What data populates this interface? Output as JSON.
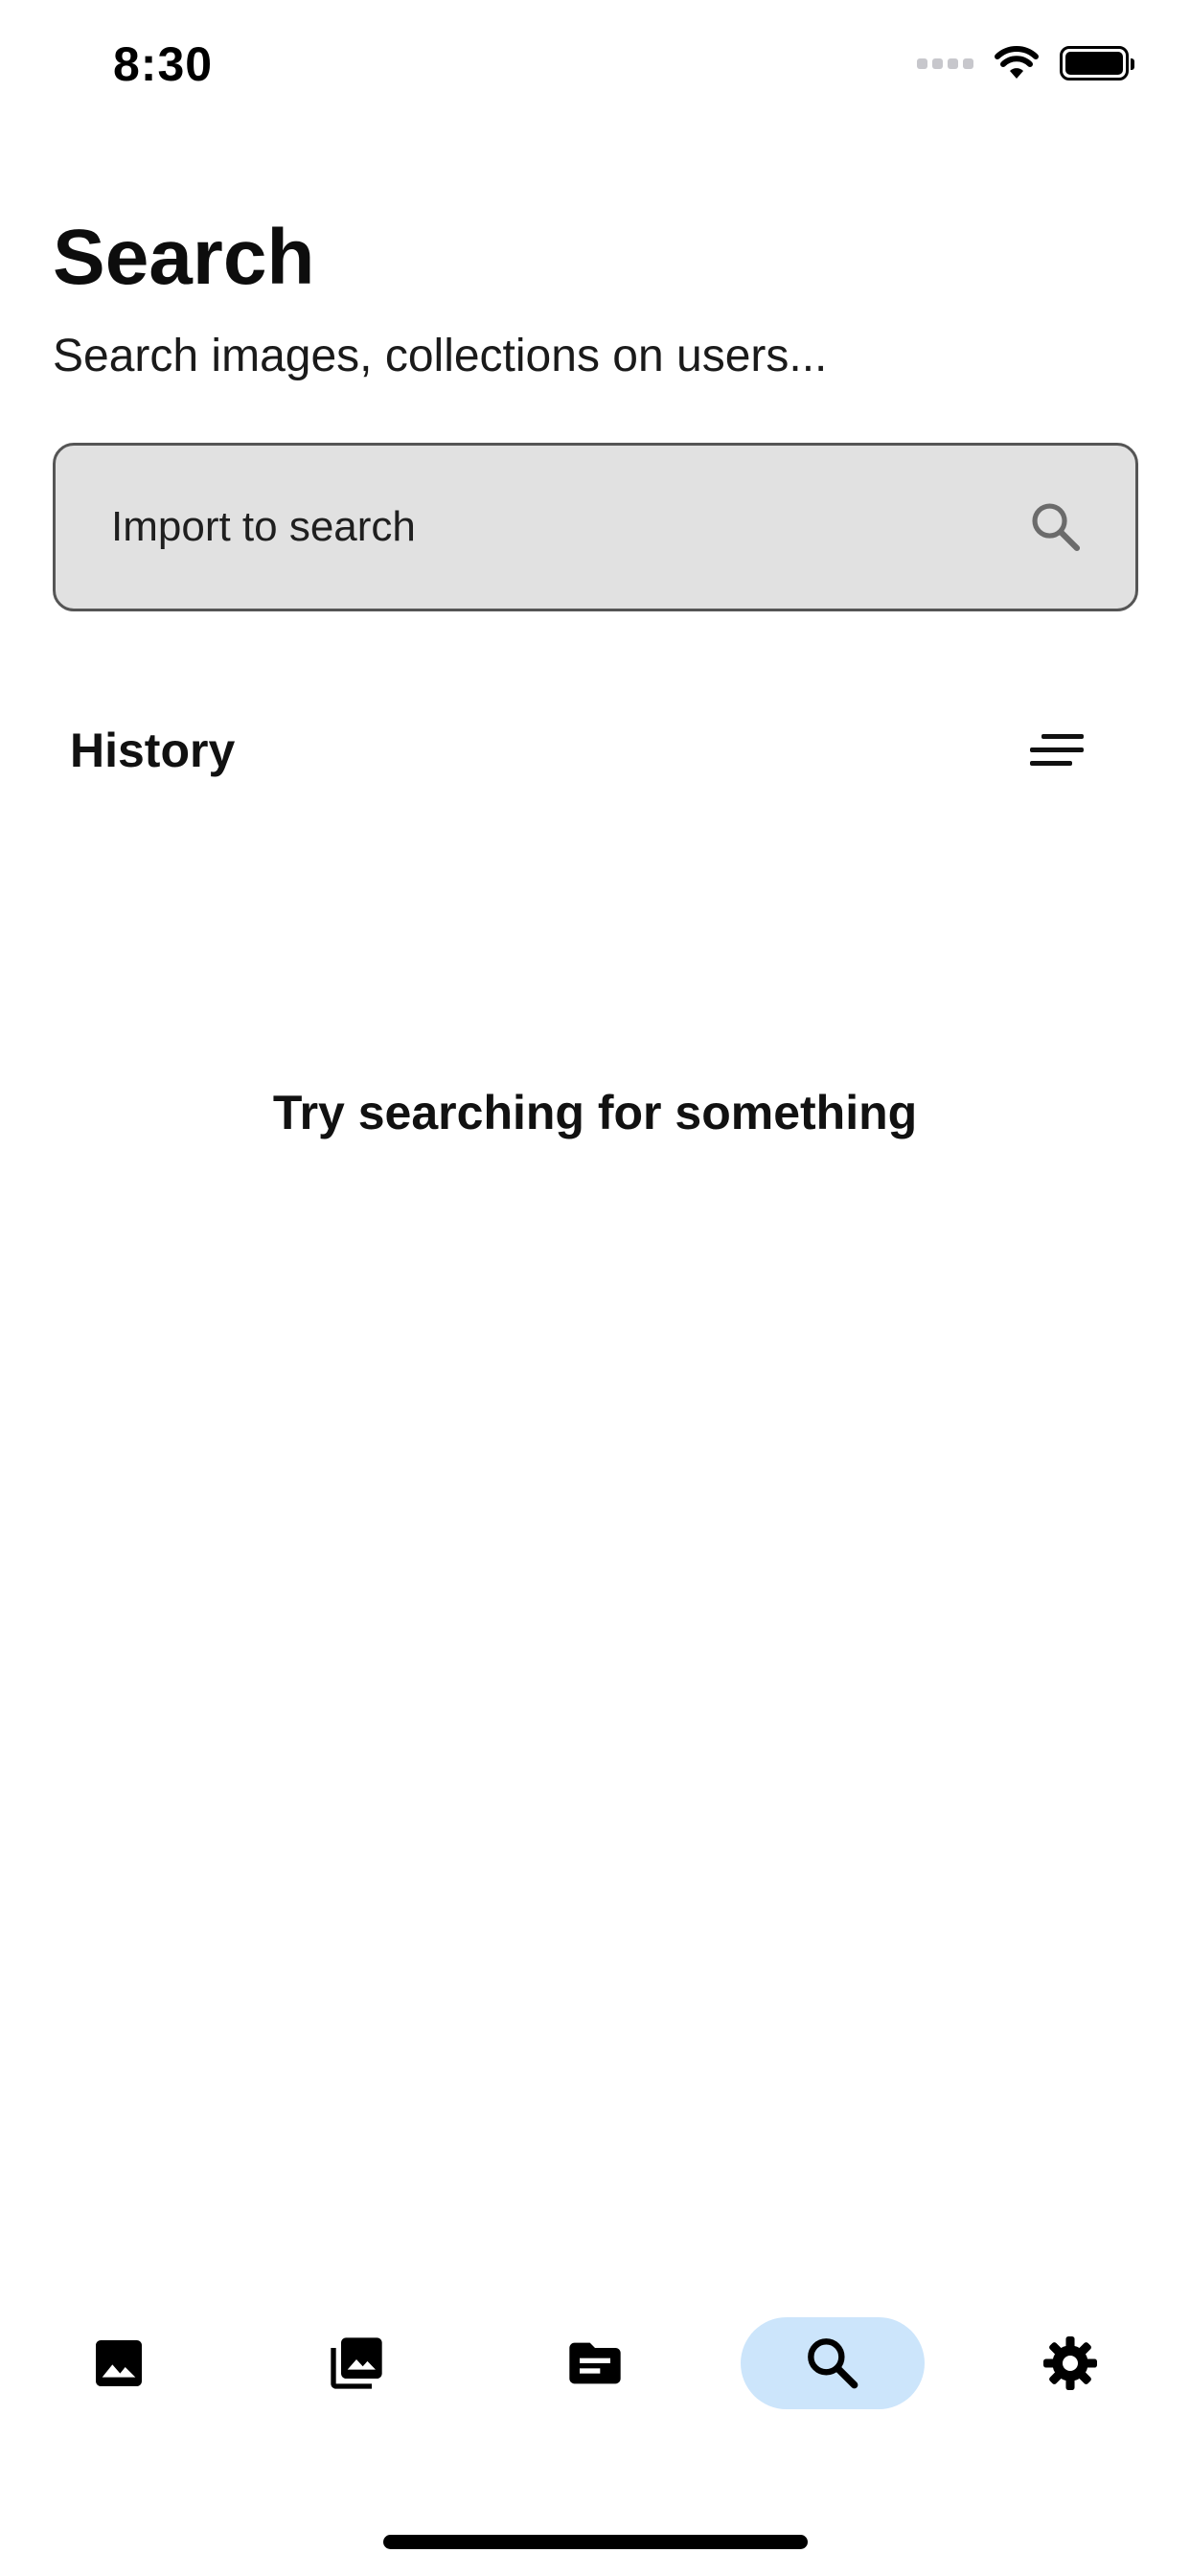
{
  "status_bar": {
    "time": "8:30",
    "icons": [
      "cellular-signal-icon",
      "wifi-icon",
      "battery-icon"
    ]
  },
  "header": {
    "title": "Search",
    "subtitle": "Search images, collections on users..."
  },
  "search": {
    "placeholder": "Import to search",
    "value": "",
    "icon": "search-icon"
  },
  "history": {
    "title": "History",
    "sort_icon": "sort-icon",
    "empty_message": "Try searching for something",
    "items": []
  },
  "bottom_nav": {
    "items": [
      {
        "id": "images",
        "icon": "image-icon",
        "active": false
      },
      {
        "id": "collections",
        "icon": "photo-library-icon",
        "active": false
      },
      {
        "id": "documents",
        "icon": "folder-icon",
        "active": false
      },
      {
        "id": "search",
        "icon": "search-icon",
        "active": true
      },
      {
        "id": "settings",
        "icon": "gear-icon",
        "active": false
      }
    ]
  },
  "colors": {
    "background": "#ffffff",
    "search_fill": "#e1e1e1",
    "search_border": "#555555",
    "nav_active_pill": "#cce5fb",
    "text": "#111111"
  }
}
